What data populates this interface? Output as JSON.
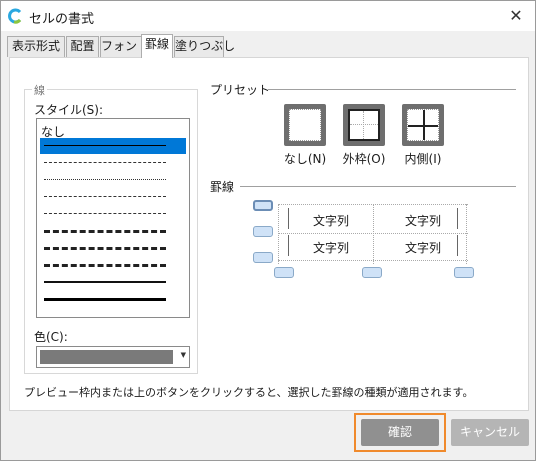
{
  "window": {
    "title": "セルの書式",
    "close_glyph": "✕"
  },
  "tabs": [
    {
      "label": "表示形式"
    },
    {
      "label": "配置"
    },
    {
      "label": "フォント"
    },
    {
      "label": "罫線"
    },
    {
      "label": "塗りつぶし"
    }
  ],
  "line_group": {
    "label": "線",
    "style_label": "スタイル(S):",
    "none_label": "なし",
    "color_label": "色(C):",
    "color_value": "#7a7a7a"
  },
  "preset": {
    "title": "プリセット",
    "buttons": [
      {
        "label": "なし(N)"
      },
      {
        "label": "外枠(O)"
      },
      {
        "label": "内側(I)"
      }
    ]
  },
  "border": {
    "title": "罫線",
    "cells": [
      "文字列",
      "文字列",
      "文字列",
      "文字列"
    ]
  },
  "footer": {
    "note": "プレビュー枠内または上のボタンをクリックすると、選択した罫線の種類が適用されます。",
    "ok_label": "確認",
    "cancel_label": "キャンセル"
  },
  "colors": {
    "accent": "#0078d7",
    "highlight": "#f08a2c"
  }
}
